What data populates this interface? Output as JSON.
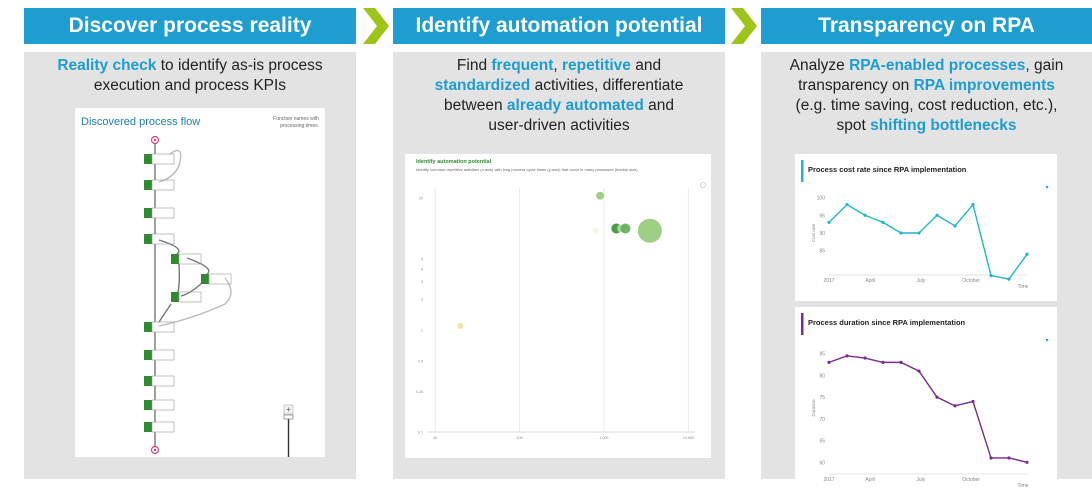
{
  "col1": {
    "header": "Discover process reality",
    "desc": {
      "hl1": "Reality check",
      "t1": " to identify as-is process",
      "t2": "execution and process KPIs"
    },
    "card": {
      "title": "Discovered process flow",
      "note1": "Function names with",
      "note2": "processing times."
    }
  },
  "col2": {
    "header": "Identify automation potential",
    "desc": {
      "t1": "Find ",
      "hl1": "frequent",
      "t2": ", ",
      "hl2": "repetitive",
      "t3": " and",
      "hl3": "standardized",
      "t4": " activities, differentiate",
      "t5": "between ",
      "hl4": "already automated",
      "t6": " and",
      "t7": "user-driven activities"
    },
    "card": {
      "title": "Identify automation potential",
      "subtitle": "Identify common repetitive activities (x-axis) with long process cycle times (y-axis) that occur in many processes (bubble size)"
    }
  },
  "col3": {
    "header": "Transparency on RPA",
    "desc": {
      "t1": "Analyze ",
      "hl1": "RPA-enabled processes",
      "t2": ", gain",
      "t3": "transparency on ",
      "hl2": "RPA improvements",
      "t4": "(e.g. time saving, cost reduction, etc.),",
      "t5": "spot ",
      "hl3": "shifting bottlenecks"
    }
  },
  "colors": {
    "header": "#1d9dd0",
    "arrow": "#9dc41a",
    "panel": "#e3e3e3",
    "flow_node": "#2e8b2e",
    "cost_line": "#22b5c9",
    "duration_line": "#7b2a8e"
  },
  "chart_data": [
    {
      "type": "scatter",
      "title": "Identify automation potential",
      "points": [
        {
          "x": 900,
          "y": 21,
          "size": 4,
          "shade": "light-green"
        },
        {
          "x": 1400,
          "y": 10,
          "size": 5,
          "shade": "dark-green"
        },
        {
          "x": 1600,
          "y": 10,
          "size": 4,
          "shade": "pale-green"
        },
        {
          "x": 1800,
          "y": 10,
          "size": 5,
          "shade": "green"
        },
        {
          "x": 3500,
          "y": 9.5,
          "size": 12,
          "shade": "light-green"
        },
        {
          "x": 800,
          "y": 9.5,
          "size": 3,
          "shade": "pale"
        },
        {
          "x": 20,
          "y": 1.1,
          "size": 3,
          "shade": "yellow"
        }
      ],
      "yticks": [
        "20",
        "5",
        "4",
        "3",
        "2",
        "1",
        "0.5",
        "0.25",
        "0.1"
      ],
      "xticks": [
        "10",
        "100",
        "1,000",
        "10,000"
      ]
    },
    {
      "type": "line",
      "title": "Process cost rate since RPA implementation",
      "ylabel": "Cost rate",
      "xlabel": "Time",
      "xticks": [
        "2017",
        "April",
        "July",
        "October"
      ],
      "yticks": [
        100,
        95,
        90,
        85
      ],
      "ylim": [
        79,
        101
      ],
      "values": [
        93,
        98,
        95,
        93,
        90,
        90,
        95,
        92,
        98,
        78,
        77,
        84
      ]
    },
    {
      "type": "line",
      "title": "Process duration since RPA implementation",
      "ylabel": "Duration",
      "xlabel": "Time",
      "xticks": [
        "2017",
        "April",
        "July",
        "October"
      ],
      "yticks": [
        85,
        80,
        75,
        70,
        65,
        60
      ],
      "ylim": [
        58,
        87
      ],
      "values": [
        83,
        84.5,
        84,
        83,
        83,
        81,
        75,
        73,
        74,
        61,
        61,
        60
      ]
    }
  ]
}
